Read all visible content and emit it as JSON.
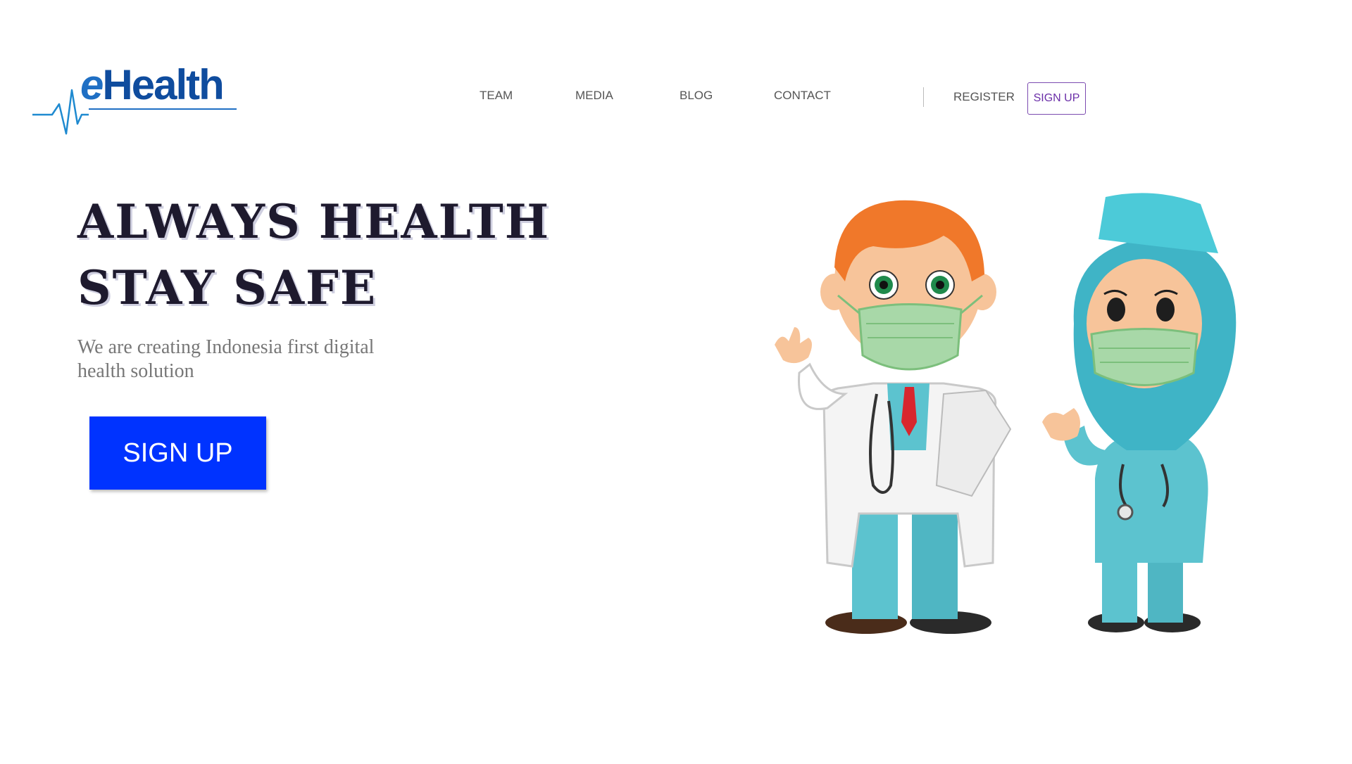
{
  "logo": {
    "e": "e",
    "rest": "Health"
  },
  "nav": {
    "items": [
      {
        "label": "TEAM"
      },
      {
        "label": "MEDIA"
      },
      {
        "label": "BLOG"
      },
      {
        "label": "CONTACT"
      }
    ],
    "register": "REGISTER",
    "signup": "SIGN UP"
  },
  "hero": {
    "title_line1": "ALWAYS HEALTH",
    "title_line2": "STAY SAFE",
    "subtitle": "We are creating Indonesia first digital health solution",
    "cta": "SIGN UP"
  },
  "colors": {
    "brand_blue": "#0f4c9e",
    "cta_blue": "#0033ff",
    "signup_purple": "#6b2fa8"
  },
  "icons": [
    "heartbeat-line-icon",
    "doctor-illustration",
    "nurse-illustration"
  ]
}
